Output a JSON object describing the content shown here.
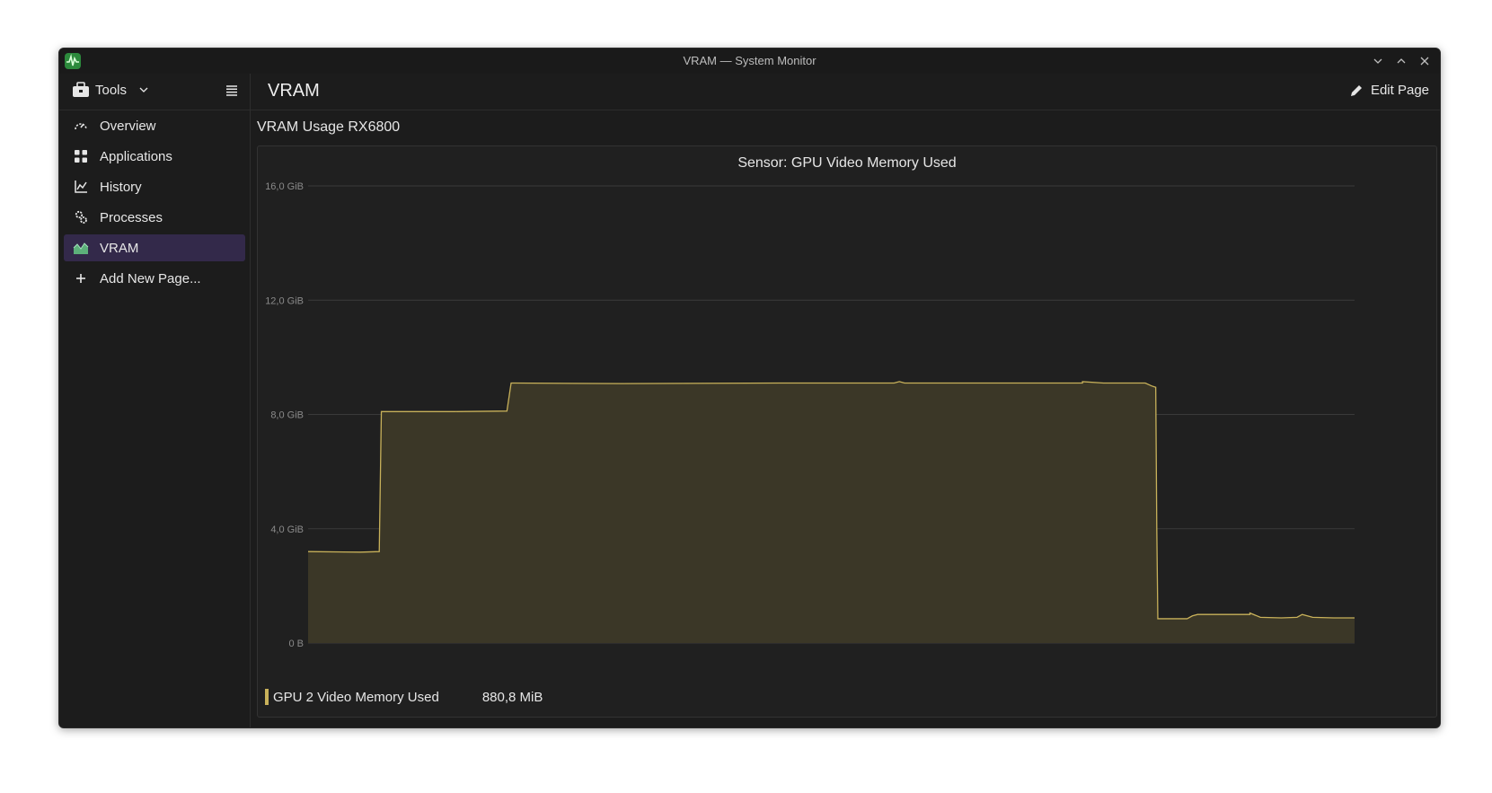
{
  "window": {
    "title": "VRAM — System Monitor"
  },
  "sidebar": {
    "tools_label": "Tools",
    "items": [
      {
        "label": "Overview",
        "icon": "overview-icon"
      },
      {
        "label": "Applications",
        "icon": "applications-grid-icon"
      },
      {
        "label": "History",
        "icon": "history-chart-icon"
      },
      {
        "label": "Processes",
        "icon": "processes-gears-icon"
      },
      {
        "label": "VRAM",
        "icon": "vram-area-chart-icon",
        "active": true
      },
      {
        "label": "Add New Page...",
        "icon": "plus-icon"
      }
    ]
  },
  "header": {
    "page_title": "VRAM",
    "edit_label": "Edit Page"
  },
  "section": {
    "title": "VRAM Usage RX6800"
  },
  "colors": {
    "accent_active": "#33294a",
    "series_line": "#c8b15a",
    "series_fill": "#3b3727",
    "background": "#1c1c1c"
  },
  "chart_data": {
    "type": "area",
    "title": "Sensor: GPU Video Memory Used",
    "xlabel": "",
    "ylabel": "",
    "ylim": [
      0,
      16
    ],
    "y_unit": "GiB",
    "y_ticks": [
      0,
      4,
      8,
      12,
      16
    ],
    "y_tick_labels": [
      "0 B",
      "4,0 GiB",
      "8,0 GiB",
      "12,0 GiB",
      "16,0 GiB"
    ],
    "grid": true,
    "xlim": [
      0,
      1
    ],
    "series": [
      {
        "name": "GPU 2 Video Memory Used",
        "current_value": "880,8 MiB",
        "x": [
          0.0,
          0.05,
          0.068,
          0.07,
          0.08,
          0.14,
          0.19,
          0.194,
          0.197,
          0.3,
          0.45,
          0.56,
          0.565,
          0.57,
          0.6,
          0.66,
          0.74,
          0.74,
          0.76,
          0.8,
          0.806,
          0.81,
          0.811,
          0.812,
          0.815,
          0.84,
          0.845,
          0.85,
          0.9,
          0.9,
          0.91,
          0.93,
          0.945,
          0.95,
          0.96,
          0.98,
          1.0
        ],
        "y": [
          3.2,
          3.18,
          3.2,
          8.1,
          8.1,
          8.1,
          8.12,
          9.1,
          9.1,
          9.08,
          9.1,
          9.1,
          9.15,
          9.1,
          9.1,
          9.1,
          9.1,
          9.15,
          9.1,
          9.1,
          9.0,
          8.95,
          4.0,
          0.85,
          0.85,
          0.85,
          0.95,
          1.0,
          1.0,
          1.05,
          0.9,
          0.88,
          0.9,
          1.0,
          0.9,
          0.88,
          0.88
        ]
      }
    ]
  }
}
